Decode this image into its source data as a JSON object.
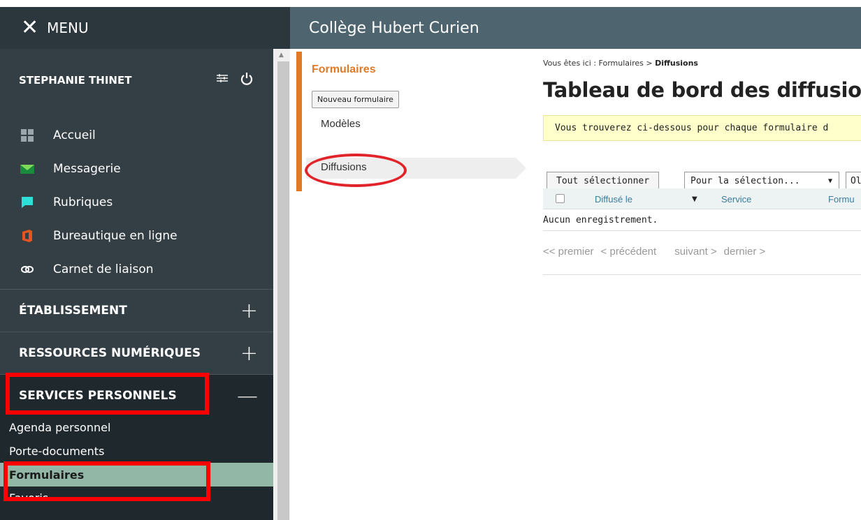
{
  "menu_bar": {
    "close_glyph": "✕",
    "label": "MENU"
  },
  "title_bar": {
    "school": "Collège Hubert Curien"
  },
  "sidebar": {
    "user_name": "STEPHANIE THINET",
    "settings_icon": "sliders-icon",
    "power_icon": "power-icon",
    "nav": [
      {
        "label": "Accueil",
        "icon": "grid-icon"
      },
      {
        "label": "Messagerie",
        "icon": "envelope-icon"
      },
      {
        "label": "Rubriques",
        "icon": "speech-bubble-icon"
      },
      {
        "label": "Bureautique en ligne",
        "icon": "office-icon"
      },
      {
        "label": "Carnet de liaison",
        "icon": "link-icon"
      }
    ],
    "sections": [
      {
        "label": "ÉTABLISSEMENT",
        "toggle": "+"
      },
      {
        "label": "RESSOURCES NUMÉRIQUES",
        "toggle": "+"
      },
      {
        "label": "SERVICES PERSONNELS",
        "toggle": "—"
      }
    ],
    "sub_items": [
      "Agenda personnel",
      "Porte-documents",
      "Formulaires",
      "Favoris"
    ]
  },
  "secondary_menu": {
    "title": "Formulaires",
    "new_button": "Nouveau formulaire",
    "items": [
      "Modèles",
      "Diffusions"
    ]
  },
  "main": {
    "breadcrumb_prefix": "Vous êtes ici : Formulaires > ",
    "breadcrumb_current": "Diffusions",
    "title": "Tableau de bord des diffusions",
    "info": "Vous trouverez ci-dessous pour chaque formulaire d",
    "select_all": "Tout sélectionner",
    "action_select": "Pour la sélection...",
    "ok_button": "Ol",
    "columns": [
      "Diffusé le",
      "Service",
      "Formu"
    ],
    "empty_text": "Aucun enregistrement.",
    "pager": [
      "<< premier",
      "< précédent",
      "suivant >",
      "dernier >"
    ]
  },
  "colors": {
    "orange_accent": "#e07a26",
    "sidebar_bg": "#343f45",
    "title_bar": "#4e6570",
    "active_item": "#92b7a7",
    "annotation": "#ff0000"
  }
}
